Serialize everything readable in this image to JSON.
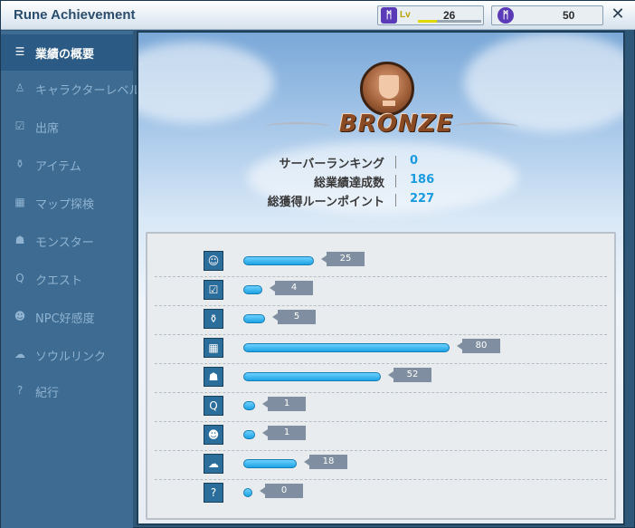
{
  "window": {
    "title": "Rune Achievement",
    "level_label": "Lv",
    "level_value": "26",
    "level_progress_percent": 30,
    "points_value": "50",
    "close_glyph": "✕"
  },
  "sidebar": {
    "items": [
      {
        "label": "業績の概要",
        "icon": "list-icon",
        "glyph": "☰",
        "active": true
      },
      {
        "label": "キャラクターレベル",
        "icon": "character-icon",
        "glyph": "♙",
        "active": false
      },
      {
        "label": "出席",
        "icon": "checkbox-icon",
        "glyph": "☑",
        "active": false
      },
      {
        "label": "アイテム",
        "icon": "potion-icon",
        "glyph": "⚱",
        "active": false
      },
      {
        "label": "マップ探検",
        "icon": "map-icon",
        "glyph": "▦",
        "active": false
      },
      {
        "label": "モンスター",
        "icon": "monster-icon",
        "glyph": "☗",
        "active": false
      },
      {
        "label": "クエスト",
        "icon": "quest-icon",
        "glyph": "Q",
        "active": false
      },
      {
        "label": "NPC好感度",
        "icon": "smiley-icon",
        "glyph": "☻",
        "active": false
      },
      {
        "label": "ソウルリンク",
        "icon": "ghost-icon",
        "glyph": "☁",
        "active": false
      },
      {
        "label": "紀行",
        "icon": "question-icon",
        "glyph": "?",
        "active": false
      }
    ]
  },
  "summary": {
    "rank": "BRONZE",
    "server_ranking_label": "サーバーランキング",
    "server_ranking_value": "0",
    "total_achievements_label": "総業績達成数",
    "total_achievements_value": "186",
    "total_rune_points_label": "総獲得ルーンポイント",
    "total_rune_points_value": "227"
  },
  "categories": [
    {
      "icon": "character-icon",
      "glyph": "☺",
      "value": "25"
    },
    {
      "icon": "checkbox-icon",
      "glyph": "☑",
      "value": "4"
    },
    {
      "icon": "potion-icon",
      "glyph": "⚱",
      "value": "5"
    },
    {
      "icon": "map-icon",
      "glyph": "▦",
      "value": "80"
    },
    {
      "icon": "monster-icon",
      "glyph": "☗",
      "value": "52"
    },
    {
      "icon": "quest-icon",
      "glyph": "Q",
      "value": "1"
    },
    {
      "icon": "smiley-icon",
      "glyph": "☻",
      "value": "1"
    },
    {
      "icon": "ghost-icon",
      "glyph": "☁",
      "value": "18"
    },
    {
      "icon": "question-icon",
      "glyph": "?",
      "value": "0"
    }
  ],
  "colors": {
    "accent": "#1ea3e4",
    "value_text": "#1a9be0",
    "bronze": "#8a4a23"
  }
}
